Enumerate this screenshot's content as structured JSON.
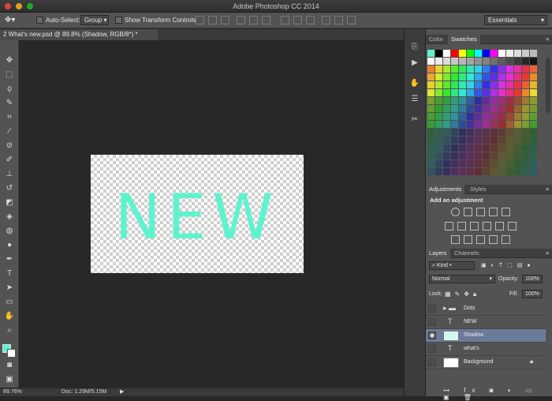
{
  "app": {
    "title": "Adobe Photoshop CC 2014"
  },
  "options": {
    "auto_select_label": "Auto-Select:",
    "auto_select_value": "Group",
    "show_transform_label": "Show Transform Controls",
    "workspace_value": "Essentials"
  },
  "document": {
    "tab_label": "2 What's new.psd @ 89.8% (Shadow, RGB/8*) *",
    "canvas_text": "NEW",
    "text_color": "#5ef3cf"
  },
  "status": {
    "zoom": "89.76%",
    "doc_size": "Doc: 1.29M/5.15M"
  },
  "panels": {
    "color_tab": "Color",
    "swatches_tab": "Swatches",
    "adjustments_tab": "Adjustments",
    "styles_tab": "Styles",
    "add_adjustment": "Add an adjustment",
    "layers_tab": "Layers",
    "channels_tab": "Channels",
    "filter_kind": "Kind",
    "blend_mode": "Normal",
    "opacity_label": "Opacity:",
    "opacity_value": "100%",
    "lock_label": "Lock:",
    "fill_label": "Fill:",
    "fill_value": "100%"
  },
  "layers": [
    {
      "name": "Dots",
      "kind": "group",
      "visible": false,
      "selected": false
    },
    {
      "name": "NEW",
      "kind": "text",
      "visible": false,
      "selected": false
    },
    {
      "name": "Shadow",
      "kind": "pixel",
      "visible": true,
      "selected": true
    },
    {
      "name": "what's",
      "kind": "text",
      "visible": false,
      "selected": false
    },
    {
      "name": "Background",
      "kind": "background",
      "visible": false,
      "selected": false
    }
  ],
  "colors": {
    "foreground": "#5ef3cf",
    "background": "#ffffff",
    "selection": "#6c7a99"
  }
}
